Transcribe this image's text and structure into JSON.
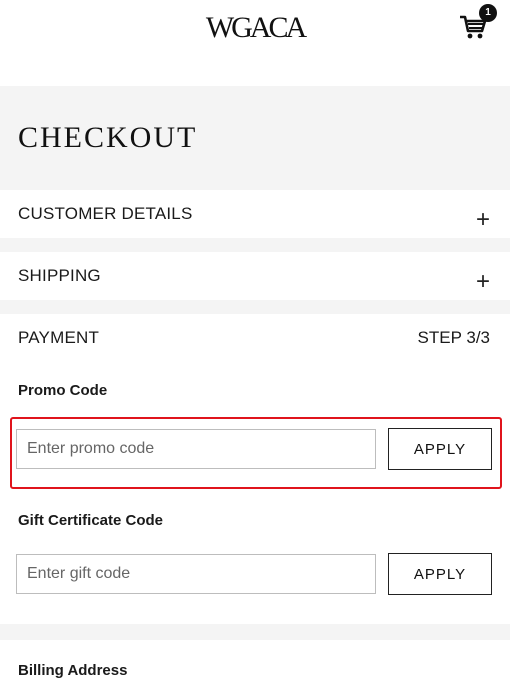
{
  "header": {
    "logo": "WGACA",
    "cart_count": "1"
  },
  "page": {
    "title": "CHECKOUT"
  },
  "sections": {
    "customer_details": {
      "label": "CUSTOMER DETAILS",
      "toggle": "+"
    },
    "shipping": {
      "label": "SHIPPING",
      "toggle": "+"
    },
    "payment": {
      "label": "PAYMENT",
      "step": "STEP 3/3"
    }
  },
  "promo": {
    "label": "Promo Code",
    "placeholder": "Enter promo code",
    "button": "APPLY"
  },
  "gift": {
    "label": "Gift Certificate Code",
    "placeholder": "Enter gift code",
    "button": "APPLY"
  },
  "billing": {
    "label": "Billing Address"
  },
  "colors": {
    "highlight": "#e0141c",
    "background_gray": "#f4f4f4"
  },
  "icons": {
    "cart": "cart-icon",
    "expand": "plus-icon"
  }
}
